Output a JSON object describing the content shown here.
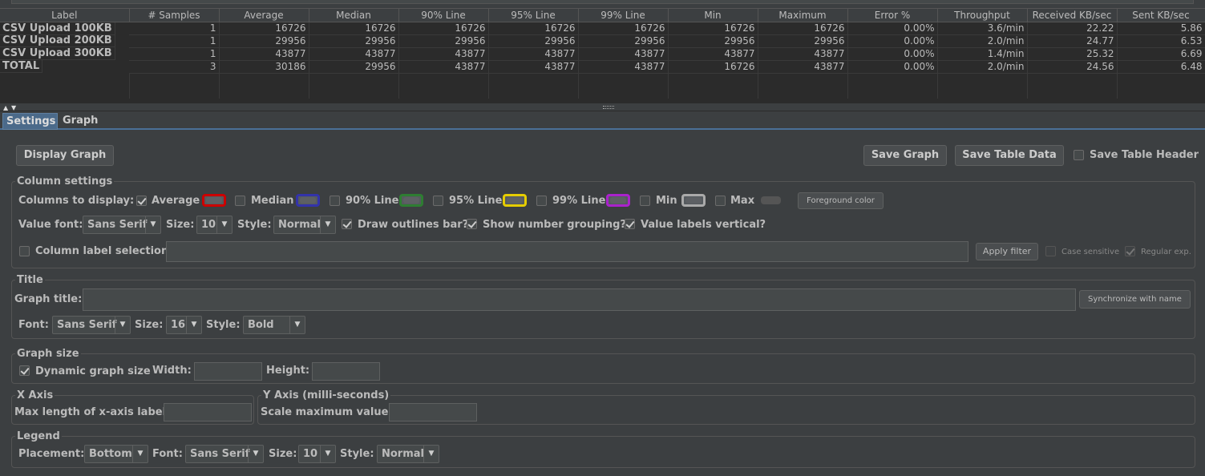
{
  "table": {
    "headers": [
      "Label",
      "# Samples",
      "Average",
      "Median",
      "90% Line",
      "95% Line",
      "99% Line",
      "Min",
      "Maximum",
      "Error %",
      "Throughput",
      "Received KB/sec",
      "Sent KB/sec"
    ],
    "rows": [
      [
        "CSV Upload 100KB",
        "1",
        "16726",
        "16726",
        "16726",
        "16726",
        "16726",
        "16726",
        "16726",
        "0.00%",
        "3.6/min",
        "22.22",
        "5.86"
      ],
      [
        "CSV Upload 200KB",
        "1",
        "29956",
        "29956",
        "29956",
        "29956",
        "29956",
        "29956",
        "29956",
        "0.00%",
        "2.0/min",
        "24.77",
        "6.53"
      ],
      [
        "CSV Upload 300KB",
        "1",
        "43877",
        "43877",
        "43877",
        "43877",
        "43877",
        "43877",
        "43877",
        "0.00%",
        "1.4/min",
        "25.32",
        "6.69"
      ],
      [
        "TOTAL",
        "3",
        "30186",
        "29956",
        "43877",
        "43877",
        "43877",
        "16726",
        "43877",
        "0.00%",
        "2.0/min",
        "24.56",
        "6.48"
      ]
    ]
  },
  "tabs": [
    {
      "label": "Settings",
      "active": true
    },
    {
      "label": "Graph",
      "active": false
    }
  ],
  "toolbar": {
    "display_graph": "Display Graph",
    "save_graph": "Save Graph",
    "save_table_data": "Save Table Data",
    "save_table_header": "Save Table Header",
    "save_table_header_checked": false
  },
  "column_settings": {
    "title": "Column settings",
    "columns_to_display": "Columns to display:",
    "columns": [
      {
        "label": "Average",
        "checked": true,
        "color": "#cc0000"
      },
      {
        "label": "Median",
        "checked": false,
        "color": "#3333aa"
      },
      {
        "label": "90% Line",
        "checked": false,
        "color": "#2e7d32"
      },
      {
        "label": "95% Line",
        "checked": false,
        "color": "#e5cc00"
      },
      {
        "label": "99% Line",
        "checked": false,
        "color": "#aa22cc"
      },
      {
        "label": "Min",
        "checked": false,
        "color": "#aaaaaa"
      },
      {
        "label": "Max",
        "checked": false,
        "color": "#555555"
      }
    ],
    "foreground_color": "Foreground color",
    "value_font_label": "Value font:",
    "value_font": "Sans Serif",
    "size_label": "Size:",
    "size": "10",
    "style_label": "Style:",
    "style": "Normal",
    "draw_outlines": {
      "label": "Draw outlines bar?",
      "checked": true
    },
    "number_grouping": {
      "label": "Show number grouping?",
      "checked": true
    },
    "labels_vertical": {
      "label": "Value labels vertical?",
      "checked": true
    },
    "column_label_selection": "Column label selection:",
    "apply_filter": "Apply filter",
    "case_sensitive": "Case sensitive",
    "regular_exp": "Regular exp."
  },
  "title_section": {
    "title": "Title",
    "graph_title_label": "Graph title:",
    "graph_title_value": "",
    "synchronize": "Synchronize with name",
    "font_label": "Font:",
    "font": "Sans Serif",
    "size_label": "Size:",
    "size": "16",
    "style_label": "Style:",
    "style": "Bold"
  },
  "graph_size": {
    "title": "Graph size",
    "dynamic": "Dynamic graph size",
    "dynamic_checked": true,
    "width_label": "Width:",
    "height_label": "Height:"
  },
  "x_axis": {
    "title": "X Axis",
    "max_length_label": "Max length of x-axis label:"
  },
  "y_axis": {
    "title": "Y Axis (milli-seconds)",
    "scale_max_label": "Scale maximum value:"
  },
  "legend": {
    "title": "Legend",
    "placement_label": "Placement:",
    "placement": "Bottom",
    "font_label": "Font:",
    "font": "Sans Serif",
    "size_label": "Size:",
    "size": "10",
    "style_label": "Style:",
    "style": "Normal"
  }
}
